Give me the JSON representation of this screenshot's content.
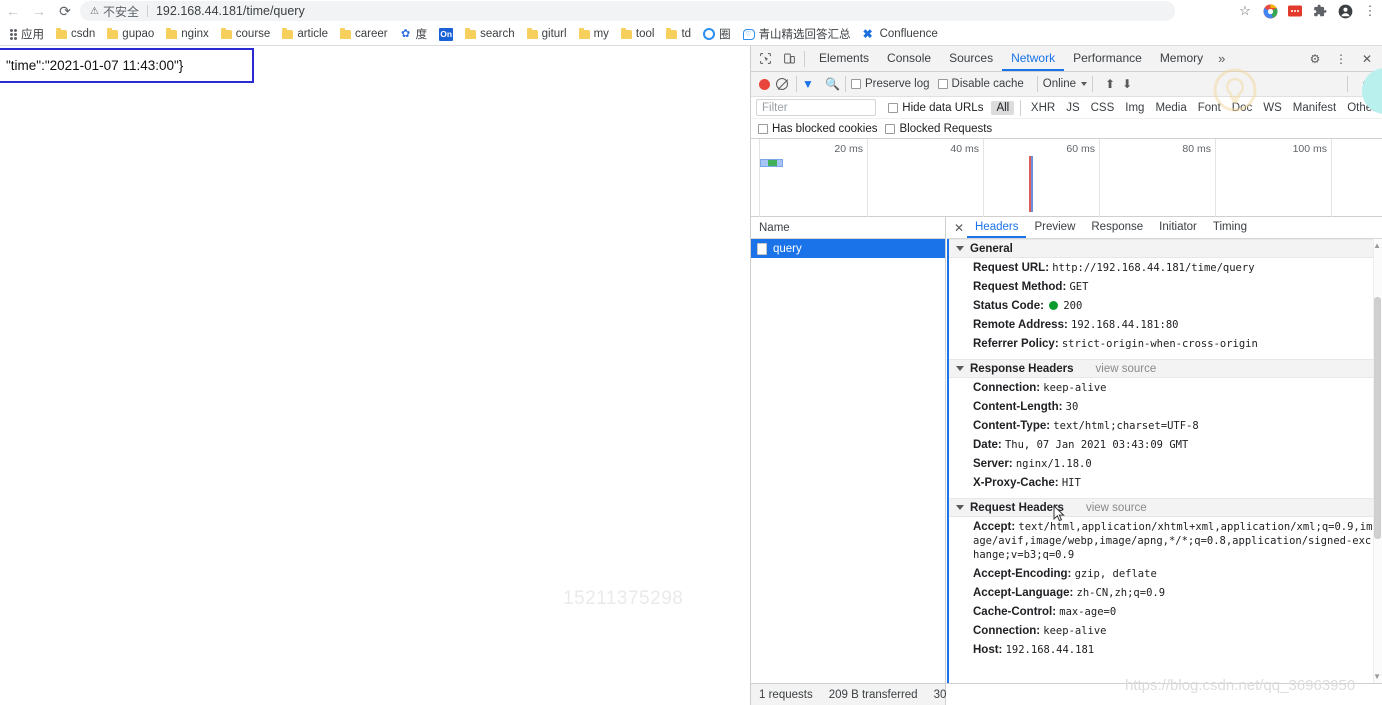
{
  "browser": {
    "nav": {
      "back": "←",
      "forward": "→",
      "reload": "⟳"
    },
    "omnibox": {
      "security_label": "不安全",
      "warning_icon": "⚠",
      "url": "192.168.44.181/time/query"
    },
    "actions": [
      {
        "name": "bookmark-star-icon",
        "glyph": "☆"
      },
      {
        "name": "extension-color-icon",
        "glyph": "◉"
      },
      {
        "name": "extension-red-icon",
        "glyph": "▪"
      },
      {
        "name": "extensions-puzzle-icon",
        "glyph": "✜"
      },
      {
        "name": "profile-avatar-icon",
        "glyph": "◕"
      },
      {
        "name": "chrome-menu-icon",
        "glyph": "⋮"
      }
    ],
    "bookmarks": [
      {
        "label": "应用",
        "icon": "apps-grid-icon"
      },
      {
        "label": "csdn",
        "icon": "folder-icon"
      },
      {
        "label": "gupao",
        "icon": "folder-icon"
      },
      {
        "label": "nginx",
        "icon": "folder-icon"
      },
      {
        "label": "course",
        "icon": "folder-icon"
      },
      {
        "label": "article",
        "icon": "folder-icon"
      },
      {
        "label": "career",
        "icon": "folder-icon"
      },
      {
        "label": "度",
        "icon": "baidu-icon"
      },
      {
        "label": "On",
        "icon": "on-badge-icon"
      },
      {
        "label": "search",
        "icon": "folder-icon"
      },
      {
        "label": "giturl",
        "icon": "folder-icon"
      },
      {
        "label": "my",
        "icon": "folder-icon"
      },
      {
        "label": "tool",
        "icon": "folder-icon"
      },
      {
        "label": "td",
        "icon": "folder-icon"
      },
      {
        "label": "圈",
        "icon": "ring-icon"
      },
      {
        "label": "青山精选回答汇总",
        "icon": "chat-icon"
      },
      {
        "label": "Confluence",
        "icon": "confluence-icon"
      }
    ]
  },
  "page": {
    "body_text": "\"time\":\"2021-01-07 11:43:00\"}",
    "watermark": "15211375298"
  },
  "devtools": {
    "panels": [
      "Elements",
      "Console",
      "Sources",
      "Network",
      "Performance",
      "Memory"
    ],
    "active_panel": "Network",
    "more_panels_glyph": "»",
    "tabstrip_icons": [
      {
        "name": "inspect-element-icon",
        "glyph": "⬈"
      },
      {
        "name": "device-toolbar-icon",
        "glyph": "❐"
      }
    ],
    "tabstrip_right_icons": [
      {
        "name": "devtools-settings-gear-icon",
        "glyph": "⚙"
      },
      {
        "name": "devtools-more-menu-icon",
        "glyph": "⋮"
      },
      {
        "name": "devtools-close-icon",
        "glyph": "✕"
      }
    ],
    "network_toolbar": {
      "record_label": "record-button",
      "clear_label": "clear-button",
      "filter_icon": "funnel-icon",
      "search_icon": "search-icon",
      "preserve_log": "Preserve log",
      "disable_cache": "Disable cache",
      "throttle_value": "Online",
      "import_icon": "⬆",
      "export_icon": "⬇",
      "settings_icon": "⚙"
    },
    "filter_row": {
      "filter_placeholder": "Filter",
      "hide_data_urls": "Hide data URLs",
      "types": [
        "All",
        "XHR",
        "JS",
        "CSS",
        "Img",
        "Media",
        "Font",
        "Doc",
        "WS",
        "Manifest",
        "Other"
      ],
      "active_type": "All",
      "has_blocked_cookies": "Has blocked cookies",
      "blocked_requests": "Blocked Requests"
    },
    "overview": {
      "ticks": [
        "20 ms",
        "40 ms",
        "60 ms",
        "80 ms",
        "100 ms"
      ]
    },
    "requests": {
      "column_header": "Name",
      "rows": [
        {
          "name": "query",
          "selected": true
        }
      ]
    },
    "detail_tabs": [
      "Headers",
      "Preview",
      "Response",
      "Initiator",
      "Timing"
    ],
    "active_detail_tab": "Headers",
    "sections": [
      {
        "title": "General",
        "view_source": "",
        "rows": [
          {
            "key": "Request URL:",
            "value": "http://192.168.44.181/time/query"
          },
          {
            "key": "Request Method:",
            "value": "GET"
          },
          {
            "key": "Status Code:",
            "value": "200",
            "status": true
          },
          {
            "key": "Remote Address:",
            "value": "192.168.44.181:80"
          },
          {
            "key": "Referrer Policy:",
            "value": "strict-origin-when-cross-origin"
          }
        ]
      },
      {
        "title": "Response Headers",
        "view_source": "view source",
        "rows": [
          {
            "key": "Connection:",
            "value": "keep-alive"
          },
          {
            "key": "Content-Length:",
            "value": "30"
          },
          {
            "key": "Content-Type:",
            "value": "text/html;charset=UTF-8"
          },
          {
            "key": "Date:",
            "value": "Thu, 07 Jan 2021 03:43:09 GMT"
          },
          {
            "key": "Server:",
            "value": "nginx/1.18.0"
          },
          {
            "key": "X-Proxy-Cache:",
            "value": "HIT",
            "highlighted": true
          }
        ]
      },
      {
        "title": "Request Headers",
        "view_source": "view source",
        "rows": [
          {
            "key": "Accept:",
            "value": "text/html,application/xhtml+xml,application/xml;q=0.9,image/avif,image/webp,image/apng,*/*;q=0.8,application/signed-exchange;v=b3;q=0.9"
          },
          {
            "key": "Accept-Encoding:",
            "value": "gzip, deflate"
          },
          {
            "key": "Accept-Language:",
            "value": "zh-CN,zh;q=0.9"
          },
          {
            "key": "Cache-Control:",
            "value": "max-age=0"
          },
          {
            "key": "Connection:",
            "value": "keep-alive"
          },
          {
            "key": "Host:",
            "value": "192.168.44.181"
          }
        ]
      }
    ],
    "status_bar": {
      "requests": "1 requests",
      "transferred": "209 B transferred",
      "resources": "30"
    }
  },
  "watermarks": {
    "blog_url": "https://blog.csdn.net/qq_36963950"
  },
  "colors": {
    "accent_blue": "#1a73e8",
    "annotation_blue": "#2a2ad0",
    "status_green": "#0a9c2e",
    "record_red": "#e8453c",
    "folder_yellow": "#f7cf5c"
  }
}
